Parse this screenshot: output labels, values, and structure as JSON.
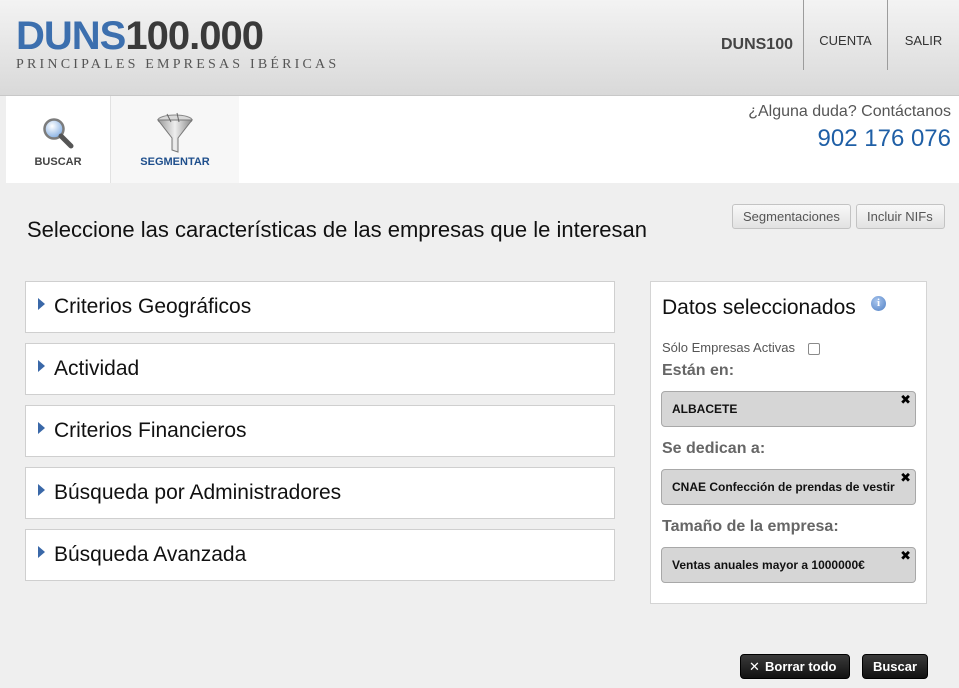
{
  "header": {
    "logo_duns": "DUNS",
    "logo_num": "100.000",
    "logo_sub": "PRINCIPALES EMPRESAS IBÉRICAS",
    "brand": "DUNS100",
    "nav": [
      {
        "label": "CUENTA"
      },
      {
        "label": "SALIR"
      }
    ]
  },
  "tabs": [
    {
      "label": "BUSCAR",
      "icon": "magnifier-icon"
    },
    {
      "label": "SEGMENTAR",
      "icon": "funnel-icon"
    }
  ],
  "contact": {
    "question": "¿Alguna duda? Contáctanos",
    "phone": "902 176 076"
  },
  "main": {
    "title": "Seleccione las características de las empresas que le interesan",
    "buttons": {
      "segmentaciones": "Segmentaciones",
      "incluir_nifs": "Incluir NIFs"
    },
    "criteria": [
      {
        "label": "Criterios Geográficos"
      },
      {
        "label": "Actividad"
      },
      {
        "label": "Criterios Financieros"
      },
      {
        "label": "Búsqueda por Administradores"
      },
      {
        "label": "Búsqueda Avanzada"
      }
    ]
  },
  "panel": {
    "title": "Datos seleccionados",
    "info_icon": "i",
    "solo_activas": "Sólo Empresas Activas",
    "solo_activas_checked": false,
    "sections": [
      {
        "label": "Están en:",
        "chip": "ALBACETE"
      },
      {
        "label": "Se dedican a:",
        "chip": "CNAE Confección de prendas de vestir"
      },
      {
        "label": "Tamaño de la empresa:",
        "chip": "Ventas anuales mayor a 1000000€"
      }
    ],
    "close_glyph": "✖"
  },
  "footer": {
    "borrar": "Borrar todo",
    "borrar_glyph": "✕",
    "buscar": "Buscar"
  },
  "colors": {
    "accent": "#3c6fae",
    "phone": "#1f5fa6",
    "tab_active": "#1f4f8c"
  }
}
